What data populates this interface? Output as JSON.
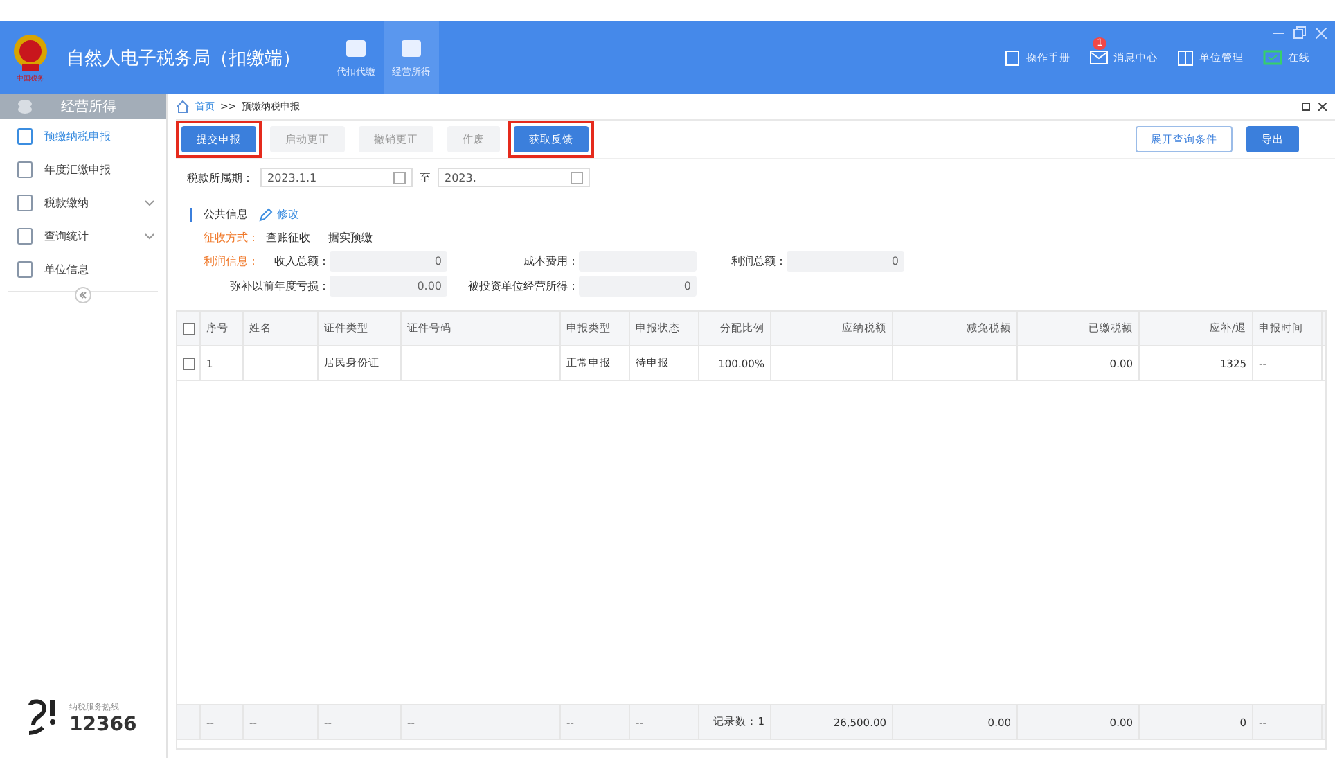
{
  "app": {
    "title": "自然人电子税务局（扣缴端）",
    "logo_text": "中国税务"
  },
  "modules": [
    {
      "label": "代扣代缴",
      "selected": false
    },
    {
      "label": "经营所得",
      "selected": true
    }
  ],
  "header_links": [
    {
      "label": "操作手册",
      "kind": "manual"
    },
    {
      "label": "消息中心",
      "kind": "mail",
      "badge": "1"
    },
    {
      "label": "单位管理",
      "kind": "org"
    },
    {
      "label": "在线",
      "kind": "online"
    }
  ],
  "sidebar": {
    "title": "经营所得",
    "items": [
      {
        "label": "预缴纳税申报",
        "selected": true,
        "expandable": false
      },
      {
        "label": "年度汇缴申报",
        "selected": false,
        "expandable": false
      },
      {
        "label": "税款缴纳",
        "selected": false,
        "expandable": true
      },
      {
        "label": "查询统计",
        "selected": false,
        "expandable": true
      },
      {
        "label": "单位信息",
        "selected": false,
        "expandable": false
      }
    ],
    "hotline_label": "纳税服务热线",
    "hotline": "12366"
  },
  "breadcrumb": {
    "home": "首页",
    "separator": ">>",
    "current": "预缴纳税申报"
  },
  "toolbar": [
    {
      "label": "提交申报",
      "disabled": false,
      "highlighted": true
    },
    {
      "label": "启动更正",
      "disabled": true,
      "highlighted": false
    },
    {
      "label": "撤销更正",
      "disabled": true,
      "highlighted": false
    },
    {
      "label": "作废",
      "disabled": true,
      "highlighted": false
    },
    {
      "label": "获取反馈",
      "disabled": false,
      "highlighted": true
    }
  ],
  "toolbar_right": [
    {
      "label": "展开查询条件",
      "kind": "outline"
    },
    {
      "label": "导出",
      "kind": "primary"
    }
  ],
  "period": {
    "label": "税款所属期：",
    "from": "2023.1.1",
    "to_label": "至",
    "to": "2023."
  },
  "public_info": {
    "title": "公共信息",
    "edit": "修改",
    "method_label": "征收方式：",
    "method": "查账征收",
    "method_2": "据实预缴",
    "profit_label": "利润信息：",
    "fields": [
      {
        "label": "收入总额：",
        "value": "0"
      },
      {
        "label": "成本费用："
      },
      {
        "label": "利润总额：",
        "value": "0"
      },
      {
        "label": "弥补以前年度亏损：",
        "value": "0.00"
      },
      {
        "label": "被投资单位经营所得：",
        "value": "0"
      }
    ]
  },
  "table": {
    "columns": [
      "序号",
      "姓名",
      "证件类型",
      "证件号码",
      "申报类型",
      "申报状态",
      "分配比例",
      "应纳税额",
      "减免税额",
      "已缴税额",
      "应补/退",
      "申报时间"
    ],
    "all_checked": false,
    "rows": [
      {
        "checked": false,
        "cells": [
          "1",
          "",
          "居民身份证",
          "",
          "正常申报",
          "待申报",
          "100.00%",
          "",
          "",
          "0.00",
          "1325",
          "--"
        ]
      }
    ],
    "totals": [
      "--",
      "--",
      "--",
      "--",
      "--",
      "--",
      "记录数：1",
      "26,500.00",
      "0.00",
      "0.00",
      "0",
      "--"
    ]
  }
}
